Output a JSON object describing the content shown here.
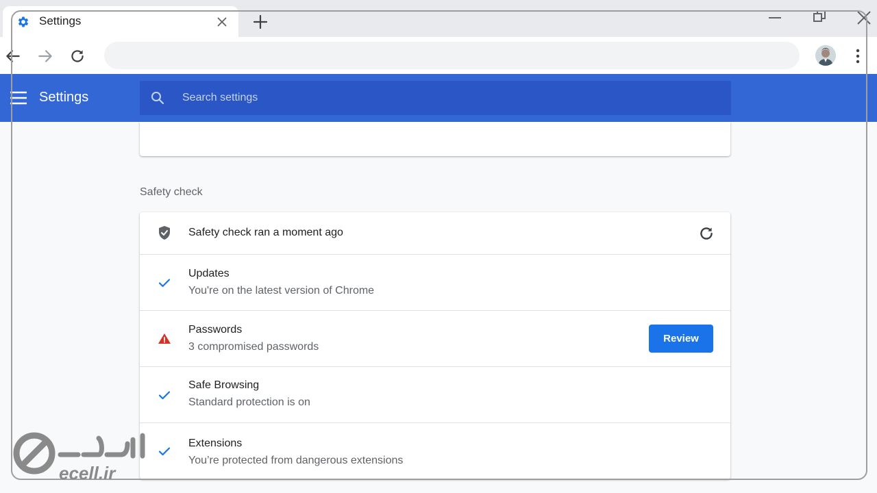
{
  "browser": {
    "tab": {
      "title": "Settings",
      "favicon": "gear-icon"
    },
    "omnibox_value": ""
  },
  "header": {
    "title": "Settings",
    "search_placeholder": "Search settings"
  },
  "safety_check": {
    "heading": "Safety check",
    "status": "Safety check ran a moment ago",
    "items": [
      {
        "title": "Updates",
        "subtitle": "You're on the latest version of Chrome",
        "icon": "checkmark-icon"
      },
      {
        "title": "Passwords",
        "subtitle": "3 compromised passwords",
        "icon": "warning-icon",
        "action": "Review"
      },
      {
        "title": "Safe Browsing",
        "subtitle": "Standard protection is on",
        "icon": "checkmark-icon"
      },
      {
        "title": "Extensions",
        "subtitle": "You’re protected from dangerous extensions",
        "icon": "checkmark-icon"
      }
    ]
  },
  "watermark": {
    "text": "ecell.ir"
  },
  "colors": {
    "header_blue": "#3367d6",
    "search_blue": "#2a56c6",
    "accent_blue": "#1a73e8",
    "warning_red": "#d93025"
  }
}
